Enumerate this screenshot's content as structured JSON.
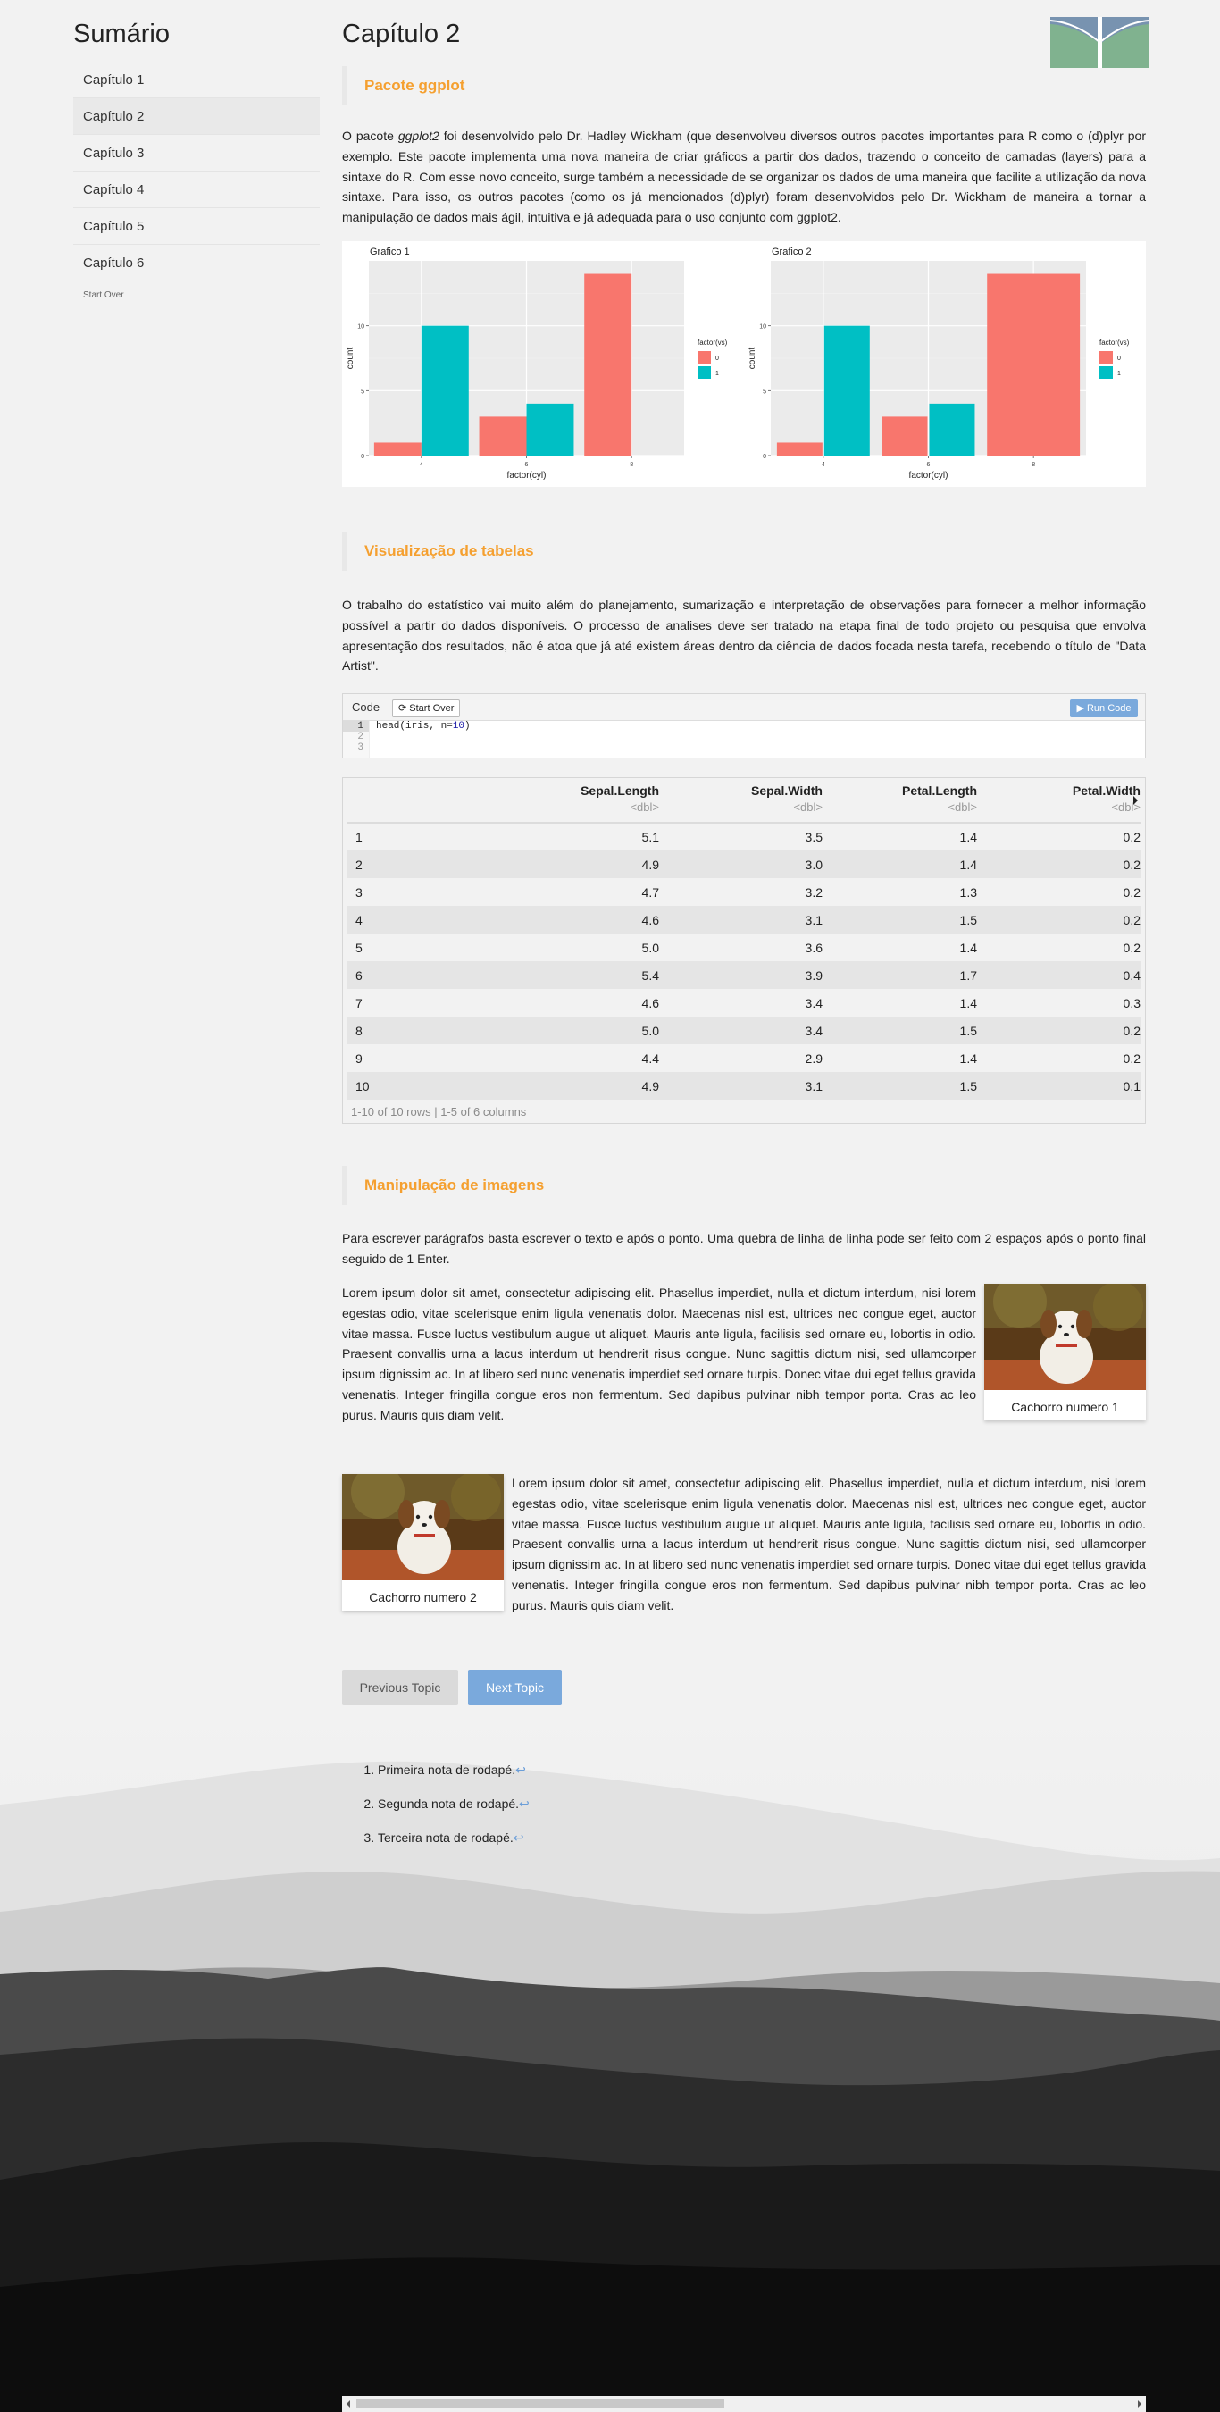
{
  "sidebar": {
    "title": "Sumário",
    "items": [
      {
        "label": "Capítulo 1"
      },
      {
        "label": "Capítulo 2"
      },
      {
        "label": "Capítulo 3"
      },
      {
        "label": "Capítulo 4"
      },
      {
        "label": "Capítulo 5"
      },
      {
        "label": "Capítulo 6"
      }
    ],
    "active_index": 1,
    "start_over": "Start Over"
  },
  "page": {
    "title": "Capítulo 2",
    "logo_icon": "university-logo-icon"
  },
  "sections": {
    "ggplot": {
      "heading": "Pacote ggplot",
      "p_before": "O pacote ",
      "p_em": "ggplot2",
      "p_after": " foi desenvolvido pelo Dr. Hadley Wickham (que desenvolveu diversos outros pacotes importantes para R como o (d)plyr por exemplo. Este pacote implementa uma nova maneira de criar gráficos a partir dos dados, trazendo o conceito de camadas (layers) para a sintaxe do R. Com esse novo conceito, surge também a necessidade de se organizar os dados de uma maneira que facilite a utilização da nova sintaxe. Para isso, os outros pacotes (como os já mencionados (d)plyr) foram desenvolvidos pelo Dr. Wickham de maneira a tornar a manipulação de dados mais ágil, intuitiva e já adequada para o uso conjunto com ggplot2."
    },
    "tables": {
      "heading": "Visualização de tabelas",
      "paragraph": "O trabalho do estatístico vai muito além do planejamento, sumarização e interpretação de observações para fornecer a melhor informação possível a partir do dados disponíveis. O processo de analises deve ser tratado na etapa final de todo projeto ou pesquisa que envolva apresentação dos resultados, não é atoa que já até existem áreas dentro da ciência de dados focada nesta tarefa, recebendo o título de \"Data Artist\"."
    },
    "images": {
      "heading": "Manipulação de imagens",
      "paragraph": "Para escrever parágrafos basta escrever o texto e após o ponto. Uma quebra de linha de linha pode ser feito com 2 espaços após o ponto final seguido de 1 Enter.",
      "lorem": "Lorem ipsum dolor sit amet, consectetur adipiscing elit. Phasellus imperdiet, nulla et dictum interdum, nisi lorem egestas odio, vitae scelerisque enim ligula venenatis dolor. Maecenas nisl est, ultrices nec congue eget, auctor vitae massa. Fusce luctus vestibulum augue ut aliquet. Mauris ante ligula, facilisis sed ornare eu, lobortis in odio. Praesent convallis urna a lacus interdum ut hendrerit risus congue. Nunc sagittis dictum nisi, sed ullamcorper ipsum dignissim ac. In at libero sed nunc venenatis imperdiet sed ornare turpis. Donec vitae dui eget tellus gravida venenatis. Integer fringilla congue eros non fermentum. Sed dapibus pulvinar nibh tempor porta. Cras ac leo purus. Mauris quis diam velit.",
      "caption1": "Cachorro numero 1",
      "caption2": "Cachorro numero 2"
    }
  },
  "code": {
    "label": "Code",
    "start_over": "Start Over",
    "run": "Run Code",
    "lines": [
      "1",
      "2",
      "3"
    ],
    "code_prefix": "head(iris, n=",
    "code_number": "10",
    "code_suffix": ")"
  },
  "table": {
    "columns": [
      {
        "name": "Sepal.Length",
        "type": "<dbl>"
      },
      {
        "name": "Sepal.Width",
        "type": "<dbl>"
      },
      {
        "name": "Petal.Length",
        "type": "<dbl>"
      },
      {
        "name": "Petal.Width",
        "type": "<dbl>"
      }
    ],
    "rows": [
      [
        "1",
        "5.1",
        "3.5",
        "1.4",
        "0.2"
      ],
      [
        "2",
        "4.9",
        "3.0",
        "1.4",
        "0.2"
      ],
      [
        "3",
        "4.7",
        "3.2",
        "1.3",
        "0.2"
      ],
      [
        "4",
        "4.6",
        "3.1",
        "1.5",
        "0.2"
      ],
      [
        "5",
        "5.0",
        "3.6",
        "1.4",
        "0.2"
      ],
      [
        "6",
        "5.4",
        "3.9",
        "1.7",
        "0.4"
      ],
      [
        "7",
        "4.6",
        "3.4",
        "1.4",
        "0.3"
      ],
      [
        "8",
        "5.0",
        "3.4",
        "1.5",
        "0.2"
      ],
      [
        "9",
        "4.4",
        "2.9",
        "1.4",
        "0.2"
      ],
      [
        "10",
        "4.9",
        "3.1",
        "1.5",
        "0.1"
      ]
    ],
    "footer": "1-10 of 10 rows | 1-5 of 6 columns"
  },
  "nav": {
    "prev": "Previous Topic",
    "next": "Next Topic"
  },
  "footnotes": [
    "Primeira nota de rodapé.",
    "Segunda nota de rodapé.",
    "Terceira nota de rodapé."
  ],
  "footnote_return": "↩",
  "colors": {
    "accent_orange": "#f5a030",
    "button_blue": "#7aa9dc",
    "series_0": "#F8766D",
    "series_1": "#00BFC4"
  },
  "chart_data": [
    {
      "type": "bar",
      "title": "Grafico 1",
      "xlabel": "factor(cyl)",
      "ylabel": "count",
      "categories": [
        "4",
        "6",
        "8"
      ],
      "legend_title": "factor(vs)",
      "series": [
        {
          "name": "0",
          "color": "#F8766D",
          "values": [
            1,
            3,
            14
          ]
        },
        {
          "name": "1",
          "color": "#00BFC4",
          "values": [
            10,
            4,
            0
          ]
        }
      ],
      "yticks": [
        0,
        5,
        10
      ],
      "ylim": [
        0,
        15
      ],
      "position": "dodge",
      "legend": "right"
    },
    {
      "type": "bar",
      "title": "Grafico 2",
      "xlabel": "factor(cyl)",
      "ylabel": "count",
      "categories": [
        "4",
        "6",
        "8"
      ],
      "legend_title": "factor(vs)",
      "series": [
        {
          "name": "0",
          "color": "#F8766D",
          "values": [
            1,
            3,
            14
          ]
        },
        {
          "name": "1",
          "color": "#00BFC4",
          "values": [
            10,
            4,
            0
          ]
        }
      ],
      "yticks": [
        0,
        5,
        10
      ],
      "ylim": [
        0,
        15
      ],
      "position": "dodge2",
      "legend": "right"
    }
  ]
}
